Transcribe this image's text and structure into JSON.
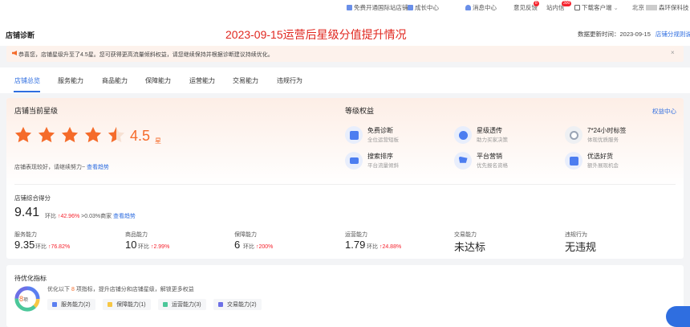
{
  "topbar": {
    "items": [
      {
        "label": "免费开通国际站店铺",
        "icon": "globe-icon",
        "color": "#2f6ee0"
      },
      {
        "label": "成长中心",
        "icon": "growth-icon",
        "color": "#2f6ee0"
      },
      {
        "label": "消息中心",
        "icon": "bell-icon",
        "color": "#2f6ee0"
      },
      {
        "label": "意见反馈",
        "badge": "8"
      },
      {
        "label": "站内信",
        "badge": "300"
      },
      {
        "label": "下载客户端",
        "icon": "download-icon"
      },
      {
        "label": "北京",
        "suffix": "森环保科技"
      }
    ]
  },
  "header": {
    "shop_title": "店铺诊断",
    "big_title": "2023-09-15运营后星级分值提升情况",
    "update_label": "数据更新时间：2023-09-15",
    "rules_link": "店铺分规则说明"
  },
  "notice": {
    "text": "恭喜您，店铺星级升至了4.5星。您可获得更高流量倾斜权益，请您继续保持并根据诊断建议持续优化。"
  },
  "tabs": [
    "店铺总览",
    "服务能力",
    "商品能力",
    "保障能力",
    "运营能力",
    "交易能力",
    "违规行为"
  ],
  "star_section": {
    "title": "店铺当前星级",
    "rating": 4.5,
    "score_text": "4.5",
    "unit": "星",
    "desc": "店铺表现较好，请继续努力~",
    "desc_link": "查看趋势"
  },
  "benefits": {
    "title": "等级权益",
    "center_link": "权益中心",
    "items": [
      {
        "name": "免费诊断",
        "sub": "全位运营短板",
        "color": "#4c7df0"
      },
      {
        "name": "星级透传",
        "sub": "助力买家决策",
        "color": "#4c7df0"
      },
      {
        "name": "7*24小时标签",
        "sub": "体现优质服务",
        "color": "#9aa4b4"
      },
      {
        "name": "搜索排序",
        "sub": "平台流量倾斜",
        "color": "#4c7df0"
      },
      {
        "name": "平台营销",
        "sub": "优先报名资格",
        "color": "#4c7df0"
      },
      {
        "name": "优选好货",
        "sub": "额外展现机会",
        "color": "#4c7df0"
      }
    ]
  },
  "total": {
    "label": "店铺综合得分",
    "value": "9.41",
    "mom_label": "环比",
    "mom_value": "42.96%",
    "beat": ">0.03%商家",
    "link": "查看趋势"
  },
  "metrics": [
    {
      "label": "服务能力",
      "value": "9.35",
      "mom_label": "环比",
      "mom": "76.82%",
      "up": true
    },
    {
      "label": "商品能力",
      "value": "10",
      "mom_label": "环比",
      "mom": "2.99%",
      "up": true
    },
    {
      "label": "保障能力",
      "value": "6",
      "mom_label": "环比",
      "mom": "200%",
      "up": true
    },
    {
      "label": "运营能力",
      "value": "1.79",
      "mom_label": "环比",
      "mom": "24.88%",
      "up": true
    },
    {
      "label": "交易能力",
      "value": "未达标",
      "mom_label": "",
      "mom": "",
      "up": false
    },
    {
      "label": "违规行为",
      "value": "无违规",
      "mom_label": "",
      "mom": "",
      "up": false
    }
  ],
  "optimize": {
    "title": "待优化指标",
    "count": "8",
    "count_unit": "项",
    "desc_pre": "优化以下",
    "desc_num": "8",
    "desc_post": "项指标，提升店铺分和店铺星级，解锁更多权益",
    "chips": [
      {
        "label": "服务能力(2)",
        "color": "#5b7ff0"
      },
      {
        "label": "保障能力(1)",
        "color": "#f7c744"
      },
      {
        "label": "运营能力(3)",
        "color": "#4cc79a"
      },
      {
        "label": "交易能力(2)",
        "color": "#6d70e6"
      }
    ]
  },
  "colors": {
    "accent": "#2f6ee0",
    "orange": "#f56b2a",
    "red_title": "#e0271f"
  }
}
